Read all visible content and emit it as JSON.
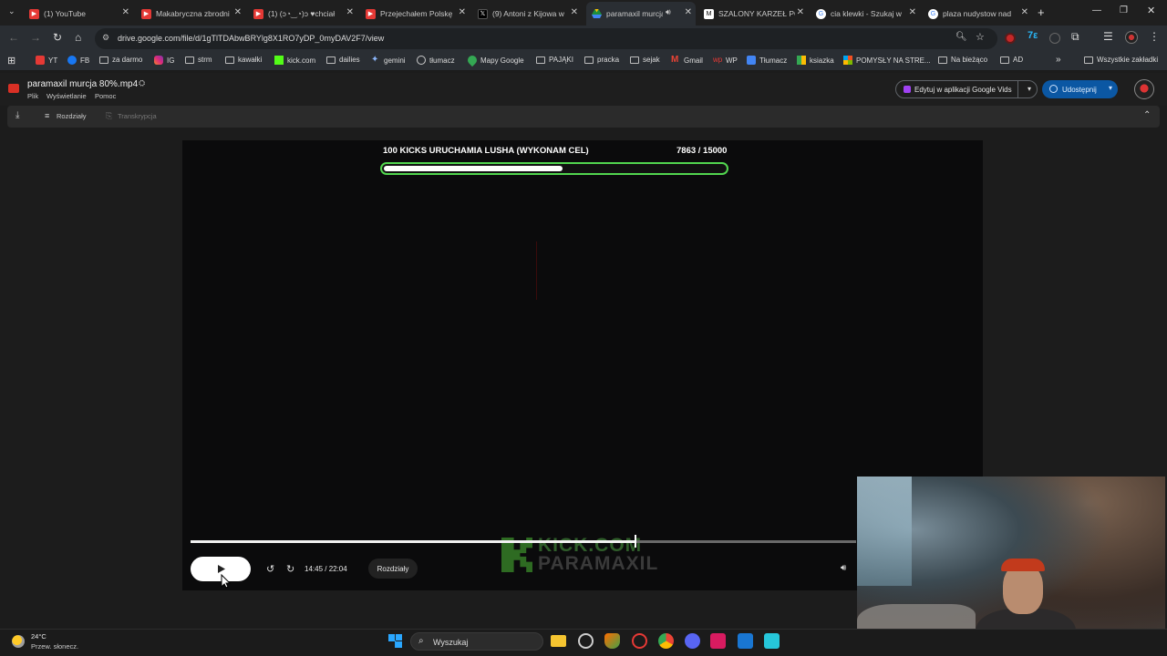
{
  "tabs": [
    {
      "title": "(1) YouTube",
      "color": "#e53935"
    },
    {
      "title": "Makabryczna zbrodni",
      "color": "#e53935"
    },
    {
      "title": "(1) (ɔ◔‿◔)ɔ ♥chciał",
      "color": "#e53935"
    },
    {
      "title": "Przejechałem Polskę",
      "color": "#e53935"
    },
    {
      "title": "(9) Antoni z Kijowa w",
      "color": "#000000"
    },
    {
      "title": "paramaxil murcja",
      "color": "#1e8e3e"
    },
    {
      "title": "SZALONY KARZEŁ PC",
      "color": "#ffffff"
    },
    {
      "title": "cia klewki - Szukaj w",
      "color": "#4285f4"
    },
    {
      "title": "plaza nudystow nad",
      "color": "#4285f4"
    }
  ],
  "address": {
    "url": "drive.google.com/file/d/1gTlTDAbwBRYlg8X1RO7yDP_0myDAV2F7/view"
  },
  "bookmarks": [
    {
      "label": "YT",
      "type": "yt"
    },
    {
      "label": "FB",
      "type": "fb"
    },
    {
      "label": "za darmo",
      "type": "folder"
    },
    {
      "label": "IG",
      "type": "ig"
    },
    {
      "label": "strm",
      "type": "folder"
    },
    {
      "label": "kawałki",
      "type": "folder"
    },
    {
      "label": "kick.com",
      "type": "kick"
    },
    {
      "label": "dailies",
      "type": "folder"
    },
    {
      "label": "gemini",
      "type": "gemini"
    },
    {
      "label": "tłumacz",
      "type": "globe"
    },
    {
      "label": "Mapy Google",
      "type": "maps"
    },
    {
      "label": "PAJĄKI",
      "type": "folder"
    },
    {
      "label": "pracka",
      "type": "folder"
    },
    {
      "label": "sejak",
      "type": "folder"
    },
    {
      "label": "Gmail",
      "type": "gmail"
    },
    {
      "label": "WP",
      "type": "wp"
    },
    {
      "label": "Tłumacz",
      "type": "translate"
    },
    {
      "label": "ksiazka",
      "type": "grid"
    },
    {
      "label": "POMYSŁY NA STRE...",
      "type": "ms"
    },
    {
      "label": "Na bieżąco",
      "type": "folder"
    },
    {
      "label": "AD",
      "type": "folder"
    }
  ],
  "bookmarks_more": "Wszystkie zakładki",
  "drive": {
    "file_title": "paramaxil murcja 80%.mp4",
    "menus": [
      "Plik",
      "Wyświetlanie",
      "Pomoc"
    ],
    "vids_button": "Edytuj w aplikacji Google Vids",
    "share_button": "Udostępnij",
    "subbar": {
      "chapters": "Rozdziały",
      "transcript": "Transkrypcja"
    }
  },
  "video": {
    "goal_text": "100 KICKS URUCHAMIA LUSHA (WYKONAM CEL)",
    "goal_count": "7863 / 15000",
    "goal_progress": 0.5242,
    "seek_progress": 0.6689,
    "time": "14:45 / 22:04",
    "chapters_button": "Rozdziały",
    "watermark_line1": "KICK.COM",
    "watermark_line2": "PARAMAXIL"
  },
  "taskbar": {
    "temp": "24°C",
    "weather": "Przew. słonecz.",
    "search_placeholder": "Wyszukaj"
  }
}
